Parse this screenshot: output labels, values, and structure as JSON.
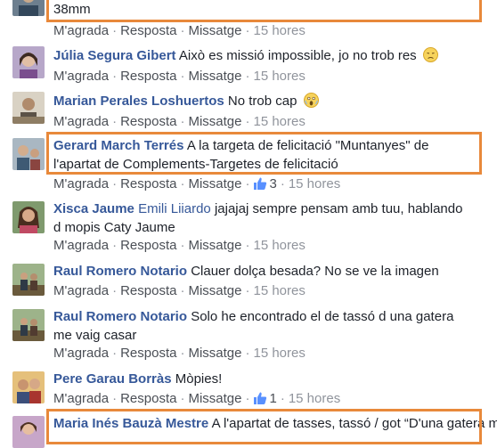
{
  "comments": [
    {
      "text": "38mm",
      "actions": {
        "like": "M'agrada",
        "reply": "Resposta",
        "message": "Missatge",
        "time": "15 hores"
      }
    },
    {
      "name": "Júlia Segura Gibert",
      "text": "Això es missió impossible, jo no trob res",
      "emoji": "disappointed-face-emoji",
      "actions": {
        "like": "M'agrada",
        "reply": "Resposta",
        "message": "Missatge",
        "time": "15 hores"
      }
    },
    {
      "name": "Marian Perales Loshuertos",
      "text": "No trob cap",
      "emoji": "screaming-face-emoji",
      "actions": {
        "like": "M'agrada",
        "reply": "Resposta",
        "message": "Missatge",
        "time": "15 hores"
      }
    },
    {
      "name": "Gerard March Terrés",
      "text": "A la targeta de felicitació \"Muntanyes\" de l'apartat de Complements-Targetes de felicitació",
      "actions": {
        "like": "M'agrada",
        "reply": "Resposta",
        "message": "Missatge",
        "likes": "3",
        "time": "15 hores"
      }
    },
    {
      "name": "Xisca Jaume",
      "mention": "Emili Liiardo",
      "text": "jajajaj sempre pensam amb tuu, hablando d mopis Caty Jaume",
      "actions": {
        "like": "M'agrada",
        "reply": "Resposta",
        "message": "Missatge",
        "time": "15 hores"
      }
    },
    {
      "name": "Raul Romero Notario",
      "text": "Clauer dolça besada? No se ve la imagen",
      "actions": {
        "like": "M'agrada",
        "reply": "Resposta",
        "message": "Missatge",
        "time": "15 hores"
      }
    },
    {
      "name": "Raul Romero Notario",
      "text": "Solo he encontrado el de tassó d una gatera me vaig casar",
      "actions": {
        "like": "M'agrada",
        "reply": "Resposta",
        "message": "Missatge",
        "time": "15 hores"
      }
    },
    {
      "name": "Pere Garau Borràs",
      "text": "Mòpies!",
      "actions": {
        "like": "M'agrada",
        "reply": "Resposta",
        "message": "Missatge",
        "likes": "1",
        "time": "15 hores"
      }
    },
    {
      "name": "Maria Inés Bauzà Mestre",
      "text": "A l'apartat de tasses, tassó / got “D'una gatera me"
    }
  ],
  "colors": {
    "name": "#365899",
    "action": "#4b4f56",
    "meta": "#90949c",
    "highlight": "#e8893b"
  }
}
